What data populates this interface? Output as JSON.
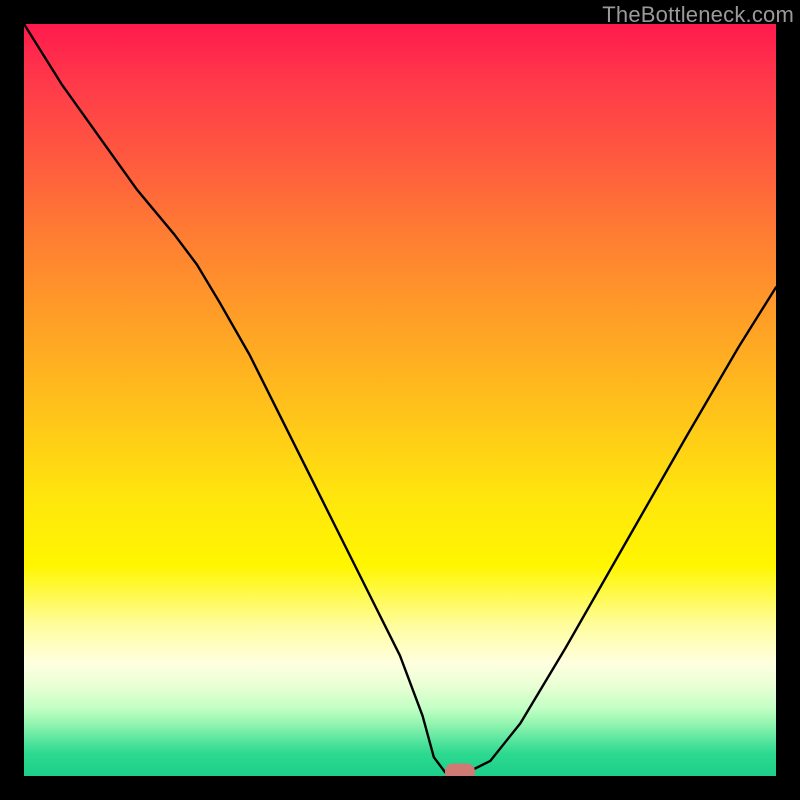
{
  "watermark": "TheBottleneck.com",
  "chart_data": {
    "type": "line",
    "title": "",
    "xlabel": "",
    "ylabel": "",
    "xlim": [
      0,
      100
    ],
    "ylim": [
      0,
      100
    ],
    "series": [
      {
        "name": "curve",
        "x": [
          0,
          5,
          10,
          15,
          20,
          23,
          26,
          30,
          34,
          38,
          42,
          46,
          50,
          53,
          54.5,
          56,
          57.5,
          59,
          62,
          66,
          72,
          80,
          88,
          95,
          100
        ],
        "y": [
          100,
          92,
          85,
          78,
          72,
          68,
          63,
          56,
          48,
          40,
          32,
          24,
          16,
          8,
          2.5,
          0.5,
          0.5,
          0.5,
          2,
          7,
          17,
          31,
          45,
          57,
          65
        ]
      }
    ],
    "marker": {
      "x": 58,
      "y": 0.5,
      "color": "#d07a74",
      "shape": "rounded-rect"
    },
    "background_gradient": {
      "stops": [
        {
          "pos": 0,
          "color": "#ff1a4d"
        },
        {
          "pos": 50,
          "color": "#ffc41a"
        },
        {
          "pos": 80,
          "color": "#fffd9e"
        },
        {
          "pos": 100,
          "color": "#1ccf8a"
        }
      ]
    }
  }
}
